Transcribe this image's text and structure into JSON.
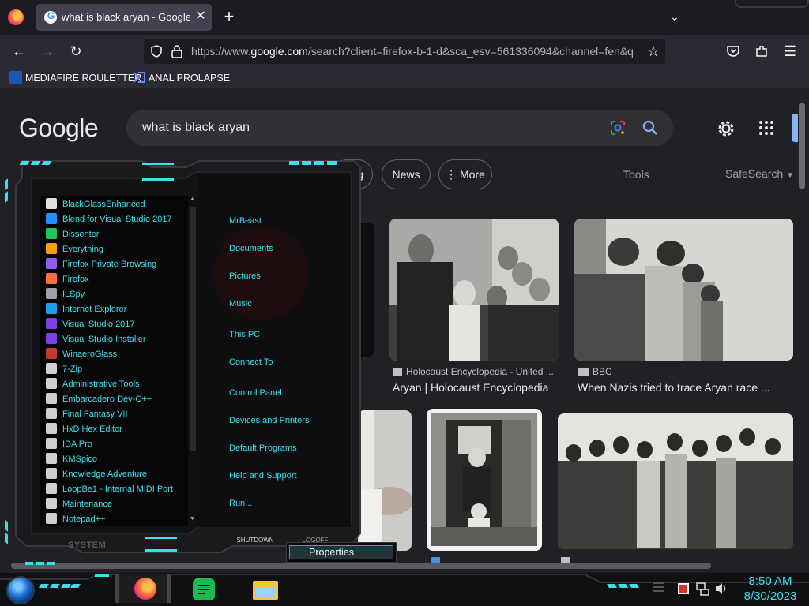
{
  "browser": {
    "tab_title": "what is black aryan - Google Se",
    "url_prefix": "https://www.",
    "url_domain": "google.com",
    "url_rest": "/search?client=firefox-b-1-d&sca_esv=561336094&channel=fen&q",
    "bookmarks": [
      "MEDIAFIRE ROULETTER",
      "ANAL PROLAPSE"
    ]
  },
  "google": {
    "logo": "Google",
    "query": "what is black aryan",
    "chips": [
      "g",
      "News",
      "⋮ More"
    ],
    "tools_label": "Tools",
    "safesearch_label": "SafeSearch"
  },
  "results": [
    {
      "source": "Holocaust Encyclopedia - United ...",
      "title": "Aryan | Holocaust Encyclopedia"
    },
    {
      "source": "BBC",
      "title": "When Nazis tried to trace Aryan race ..."
    }
  ],
  "start_menu": {
    "programs": [
      "BlackGlassEnhanced",
      "Blend for Visual Studio 2017",
      "Dissenter",
      "Everything",
      "Firefox Private Browsing",
      "Firefox",
      "ILSpy",
      "Internet Explorer",
      "Visual Studio 2017",
      "Visual Studio Installer",
      "WinaeroGlass",
      "7-Zip",
      "Administrative Tools",
      "Embarcadero Dev-C++",
      "Final Fantasy VII",
      "HxD Hex Editor",
      "IDA Pro",
      "KMSpico",
      "Knowledge Adventure",
      "LoopBe1 - Internal MIDI Port",
      "Maintenance",
      "Notepad++"
    ],
    "places": [
      "MrBeast",
      "Documents",
      "Pictures",
      "Music",
      "This PC",
      "Connect To",
      "Control Panel",
      "Devices and Printers",
      "Default Programs",
      "Help and Support",
      "Run..."
    ],
    "system_label": "SYSTEM",
    "shutdown_label": "SHUTDOWN",
    "logoff_label": "LOGOFF"
  },
  "context_menu": {
    "item": "Properties"
  },
  "taskbar": {
    "time": "8:50 AM",
    "date": "8/30/2023"
  },
  "colors": {
    "accent": "#37e0ef",
    "page_bg": "#202124",
    "chrome_bg": "#2b2a33"
  }
}
